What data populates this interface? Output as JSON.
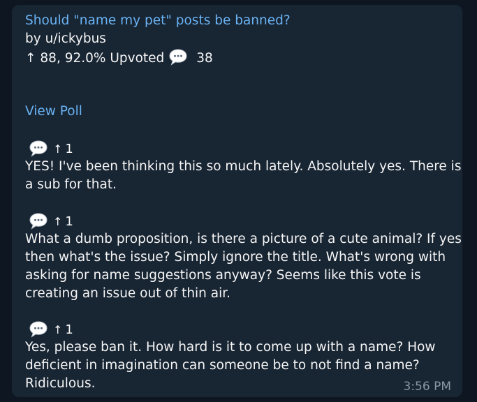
{
  "post": {
    "title": "Should \"name my pet\" posts be banned?",
    "author": "by u/ickybus",
    "arrow_glyph": "↑",
    "stats": "88, 92.0% Upvoted",
    "comment_count": "38",
    "view_poll": "View Poll"
  },
  "comments": [
    {
      "score": "1",
      "lines": [
        " YES! I've been thinking this so much lately. Absolutely yes. There is",
        "a sub for that."
      ]
    },
    {
      "score": "1",
      "lines": [
        " What a dumb proposition, is there a picture of a cute animal? If yes",
        "then what's the issue? Simply ignore the title. What's wrong with",
        "asking for name suggestions anyway? Seems like this vote is",
        "creating an issue out of thin air."
      ]
    },
    {
      "score": "1",
      "lines": [
        " Yes, please ban it. How hard is it to come up with a name? How",
        "deficient in imagination can someone be to not find a name?",
        "Ridiculous."
      ]
    }
  ],
  "message": {
    "time": "3:56 PM"
  },
  "colors": {
    "background": "#0e1621",
    "bubble": "#182533",
    "link": "#6ab3f3",
    "text": "#f5f5f5",
    "time": "#8a97a5"
  },
  "icons": {
    "comment": "speech-bubble-icon",
    "upvote": "up-arrow-icon"
  }
}
